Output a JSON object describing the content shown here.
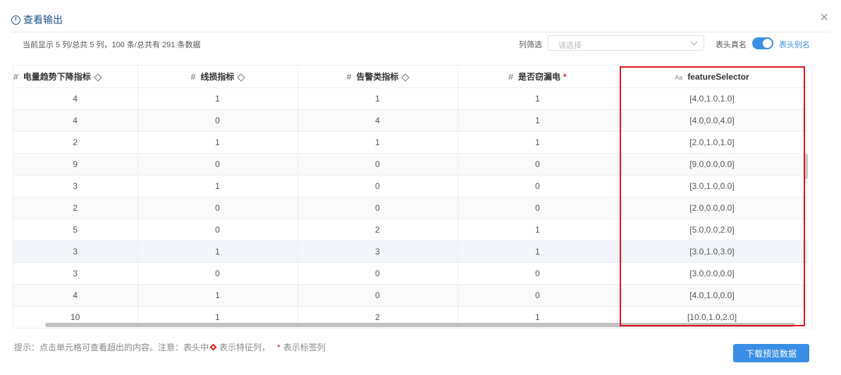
{
  "dialog": {
    "title": "查看输出",
    "close_label": "×"
  },
  "toolbar": {
    "info": "当前显示 5 列/总共 5 列，100 条/总共有 291 条数据",
    "filter_label": "列筛选",
    "filter_placeholder": "请选择",
    "real_name_label": "表头真名",
    "alias_label": "表头别名",
    "toggle_on": true
  },
  "table": {
    "columns": [
      {
        "type_icon": "#",
        "label": "电量趋势下降指标",
        "feature": true,
        "label_col": false
      },
      {
        "type_icon": "#",
        "label": "线损指标",
        "feature": true,
        "label_col": false
      },
      {
        "type_icon": "#",
        "label": "告警类指标",
        "feature": true,
        "label_col": false
      },
      {
        "type_icon": "#",
        "label": "是否窃漏电",
        "feature": false,
        "label_col": true
      },
      {
        "type_icon": "Aa",
        "label": "featureSelector",
        "feature": false,
        "label_col": false
      }
    ],
    "rows": [
      [
        "4",
        "1",
        "1",
        "1",
        "[4.0,1.0,1.0]"
      ],
      [
        "4",
        "0",
        "4",
        "1",
        "[4.0,0.0,4.0]"
      ],
      [
        "2",
        "1",
        "1",
        "1",
        "[2.0,1.0,1.0]"
      ],
      [
        "9",
        "0",
        "0",
        "0",
        "[9.0,0.0,0.0]"
      ],
      [
        "3",
        "1",
        "0",
        "0",
        "[3.0,1.0,0.0]"
      ],
      [
        "2",
        "0",
        "0",
        "0",
        "[2.0,0.0,0.0]"
      ],
      [
        "5",
        "0",
        "2",
        "1",
        "[5.0,0.0,2.0]"
      ],
      [
        "3",
        "1",
        "3",
        "1",
        "[3.0,1.0,3.0]"
      ],
      [
        "3",
        "0",
        "0",
        "0",
        "[3.0,0.0,0.0]"
      ],
      [
        "4",
        "1",
        "0",
        "0",
        "[4.0,1.0,0.0]"
      ],
      [
        "10",
        "1",
        "2",
        "1",
        "[10.0,1.0,2.0]"
      ]
    ]
  },
  "footer": {
    "tip_prefix": "提示：点击单元格可查看超出的内容。注意：表头中",
    "tip_feature": "表示特征列，",
    "tip_label": "表示标签列",
    "download_label": "下载预览数据"
  },
  "colors": {
    "accent": "#3a8ee6",
    "title": "#1f4f8a",
    "highlight_border": "#e0141e"
  }
}
